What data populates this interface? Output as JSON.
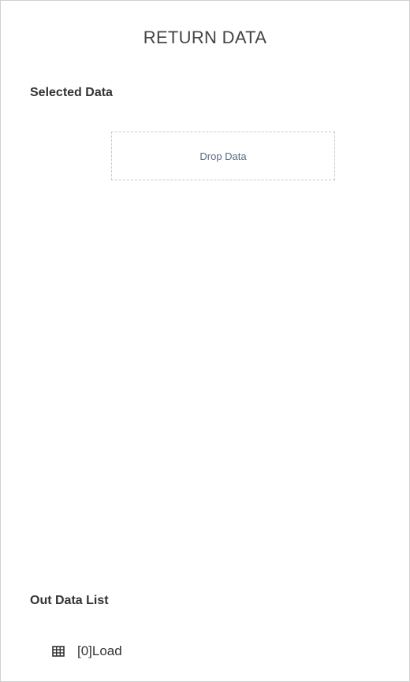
{
  "panel": {
    "title": "RETURN DATA"
  },
  "selected_data": {
    "label": "Selected Data",
    "drop_zone_text": "Drop Data"
  },
  "out_data_list": {
    "label": "Out Data List",
    "items": [
      {
        "icon": "table-icon",
        "label": "[0]Load"
      }
    ]
  }
}
